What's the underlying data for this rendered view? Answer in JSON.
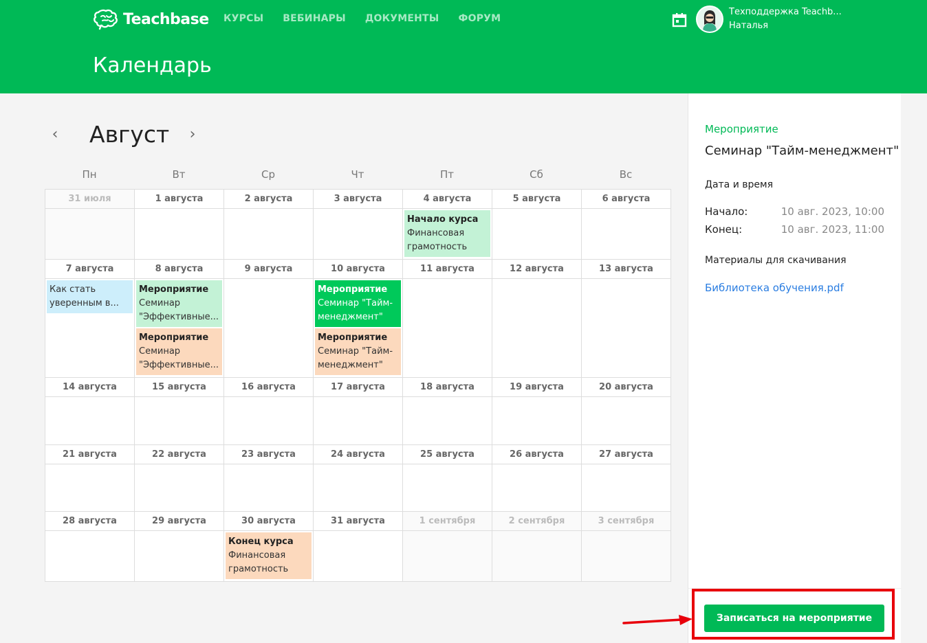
{
  "header": {
    "brand": "Teachbase",
    "nav": [
      "КУРСЫ",
      "ВЕБИНАРЫ",
      "ДОКУМЕНТЫ",
      "ФОРУМ"
    ],
    "user_name": "Техподдержка Teachb...",
    "user_sub": "Наталья",
    "page_title": "Календарь"
  },
  "calendar": {
    "month": "Август",
    "prev_icon": "chevron-left-icon",
    "next_icon": "chevron-right-icon",
    "weekdays": [
      "Пн",
      "Вт",
      "Ср",
      "Чт",
      "Пт",
      "Сб",
      "Вс"
    ],
    "weeks": [
      [
        "31 июля",
        "1 августа",
        "2 августа",
        "3 августа",
        "4 августа",
        "5 августа",
        "6 августа"
      ],
      [
        "7 августа",
        "8 августа",
        "9 августа",
        "10 августа",
        "11 августа",
        "12 августа",
        "13 августа"
      ],
      [
        "14 августа",
        "15 августа",
        "16 августа",
        "17 августа",
        "18 августа",
        "19 августа",
        "20 августа"
      ],
      [
        "21 августа",
        "22 августа",
        "23 августа",
        "24 августа",
        "25 августа",
        "26 августа",
        "27 августа"
      ],
      [
        "28 августа",
        "29 августа",
        "30 августа",
        "31 августа",
        "1 сентября",
        "2 сентября",
        "3 сентября"
      ]
    ],
    "events": {
      "w0_fri": {
        "title": "Начало курса",
        "text": "Финансовая грамотность"
      },
      "w1_mon": {
        "text": "Как стать уверенным в..."
      },
      "w1_tue_a": {
        "title": "Мероприятие",
        "text": "Семинар \"Эффективные..."
      },
      "w1_tue_b": {
        "title": "Мероприятие",
        "text": "Семинар \"Эффективные..."
      },
      "w1_thu_a": {
        "title": "Мероприятие",
        "text": "Семинар \"Тайм-менеджмент\""
      },
      "w1_thu_b": {
        "title": "Мероприятие",
        "text": "Семинар \"Тайм-менеджмент\""
      },
      "w4_wed": {
        "title": "Конец курса",
        "text": "Финансовая грамотность"
      }
    }
  },
  "panel": {
    "type": "Мероприятие",
    "name": "Семинар \"Тайм-менеджмент\"",
    "datetime_heading": "Дата и время",
    "start_label": "Начало:",
    "start_value": "10 авг. 2023, 10:00",
    "end_label": "Конец:",
    "end_value": "10 авг. 2023, 11:00",
    "materials_heading": "Материалы для скачивания",
    "file": "Библиотека обучения.pdf",
    "signup_button": "Записаться на мероприятие"
  },
  "colors": {
    "brand": "#00b956",
    "event_light_green": "#c3f2d6",
    "event_green": "#00c95a",
    "event_peach": "#fcd9bd",
    "event_blue": "#cdeefb",
    "annotation_red": "#e8000b"
  }
}
